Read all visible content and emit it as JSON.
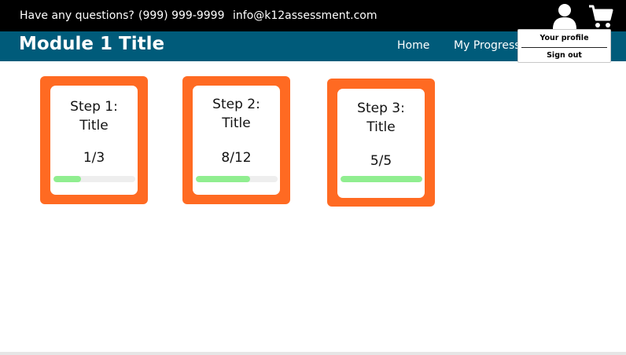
{
  "topbar": {
    "question": "Have any questions?",
    "phone": "(999) 999-9999",
    "email": "info@k12assessment.com",
    "profile_icon": "user-icon",
    "cart_icon": "cart-icon"
  },
  "header": {
    "title": "Module 1 Title",
    "nav": {
      "home": "Home",
      "progress": "My Progress"
    }
  },
  "dropdown": {
    "profile": "Your profile",
    "signout": "Sign out"
  },
  "colors": {
    "topbar": "#000000",
    "header": "#005b7a",
    "card_border": "#ff6a22",
    "progress_fill": "#90ee90"
  },
  "steps": [
    {
      "title_line1": "Step 1:",
      "title_line2": "Title",
      "count": "1/3",
      "progress": 0.333
    },
    {
      "title_line1": "Step 2:",
      "title_line2": "Title",
      "count": "8/12",
      "progress": 0.667
    },
    {
      "title_line1": "Step 3:",
      "title_line2": "Title",
      "count": "5/5",
      "progress": 1.0
    }
  ]
}
